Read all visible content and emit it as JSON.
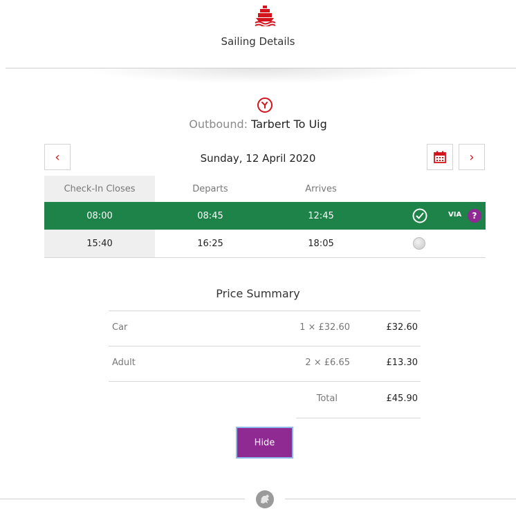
{
  "header": {
    "title": "Sailing Details",
    "brand_icon": "ship-logo-icon",
    "brand_color": "#d4141c"
  },
  "outbound": {
    "label": "Outbound:",
    "route": "Tarbert To Uig",
    "icon": "clock-icon"
  },
  "date_nav": {
    "prev_symbol": "‹",
    "next_symbol": "›",
    "date": "Sunday, 12 April 2020",
    "calendar_icon": "calendar-icon"
  },
  "sailings": {
    "columns": [
      "Check-In Closes",
      "Departs",
      "Arrives"
    ],
    "rows": [
      {
        "check_in": "08:00",
        "departs": "08:45",
        "arrives": "12:45",
        "selected": true,
        "via": "VIA",
        "help": "?"
      },
      {
        "check_in": "15:40",
        "departs": "16:25",
        "arrives": "18:05",
        "selected": false
      }
    ],
    "selected_color": "#1e8348"
  },
  "price_summary": {
    "title": "Price Summary",
    "items": [
      {
        "name": "Car",
        "qty": "1 × £32.60",
        "amount": "£32.60"
      },
      {
        "name": "Adult",
        "qty": "2 × £6.65",
        "amount": "£13.30"
      }
    ],
    "total_label": "Total",
    "total_amount": "£45.90"
  },
  "actions": {
    "hide_label": "Hide",
    "accent": "#8e2a92"
  },
  "footer": {
    "emblem_icon": "lion-emblem-icon"
  }
}
